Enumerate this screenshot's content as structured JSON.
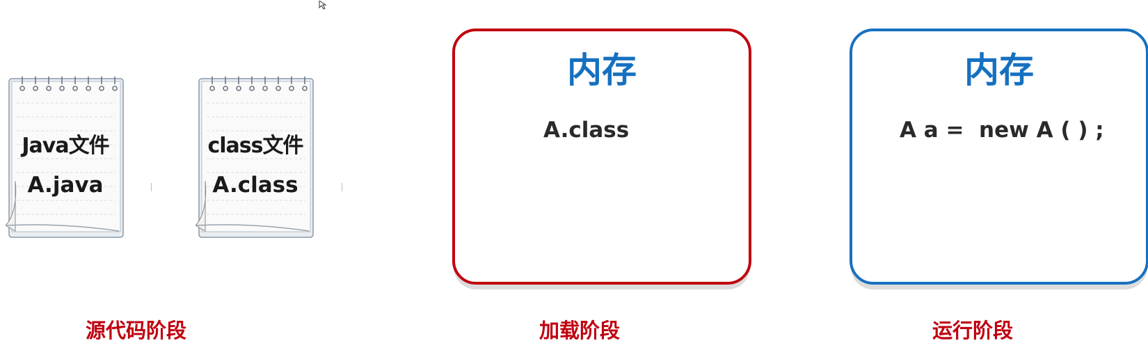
{
  "source_stage": {
    "files": [
      {
        "type_label": "Java文件",
        "file_name": "A.java"
      },
      {
        "type_label": "class文件",
        "file_name": "A.class"
      }
    ],
    "label": "源代码阶段"
  },
  "load_stage": {
    "title": "内存",
    "content": "A.class",
    "label": "加载阶段"
  },
  "run_stage": {
    "title": "内存",
    "content": "A a =  new A ( ) ;",
    "label": "运行阶段"
  },
  "colors": {
    "stage_label": "#c00010",
    "load_border": "#c00010",
    "run_border": "#1670c0",
    "memory_title": "#1670c0"
  }
}
